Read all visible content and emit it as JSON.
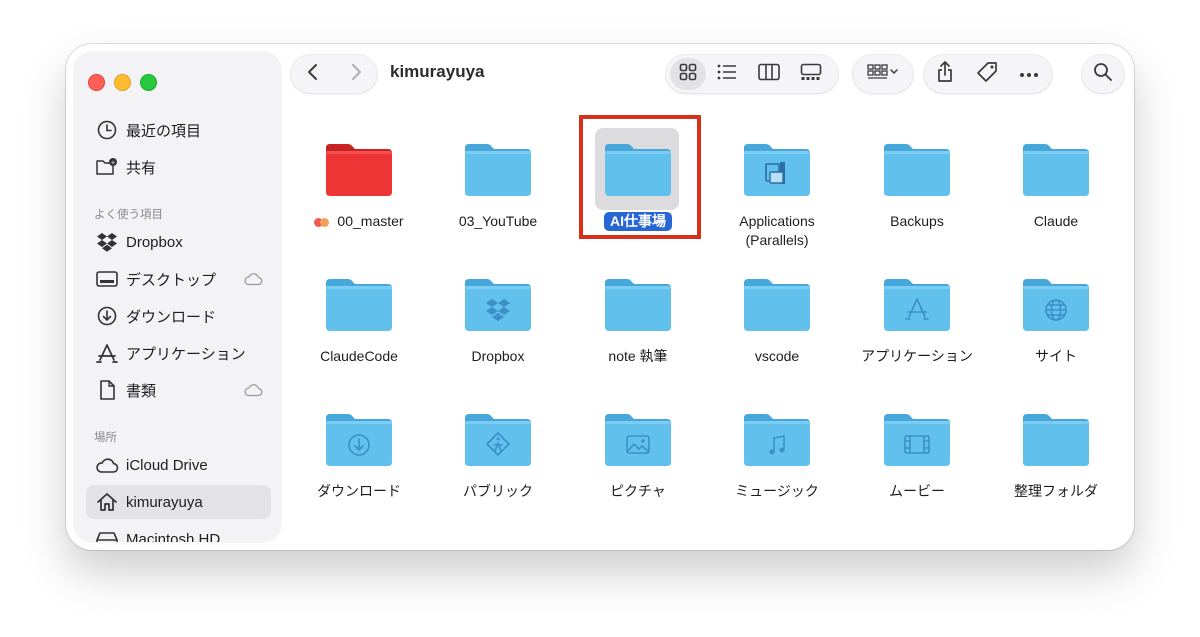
{
  "window": {
    "title": "kimurayuya"
  },
  "sidebar": {
    "top_items": [
      {
        "label": "最近の項目",
        "icon": "clock-icon"
      },
      {
        "label": "共有",
        "icon": "shared-folder-icon"
      }
    ],
    "favorites_header": "よく使う項目",
    "favorites": [
      {
        "label": "Dropbox",
        "icon": "dropbox-icon"
      },
      {
        "label": "デスクトップ",
        "icon": "desktop-icon",
        "cloud": true
      },
      {
        "label": "ダウンロード",
        "icon": "download-icon"
      },
      {
        "label": "アプリケーション",
        "icon": "applications-icon"
      },
      {
        "label": "書類",
        "icon": "document-icon",
        "cloud": true
      }
    ],
    "locations_header": "場所",
    "locations": [
      {
        "label": "iCloud Drive",
        "icon": "icloud-icon"
      },
      {
        "label": "kimurayuya",
        "icon": "home-icon",
        "selected": true
      },
      {
        "label": "Macintosh HD",
        "icon": "hard-drive-icon"
      }
    ]
  },
  "toolbar": {
    "back_icon": "chevron-left-icon",
    "forward_icon": "chevron-right-icon",
    "view_modes": [
      "icon-view-icon",
      "list-view-icon",
      "column-view-icon",
      "gallery-view-icon"
    ],
    "active_view": "icon-view-icon",
    "group_icon": "group-by-icon",
    "share_icon": "share-icon",
    "tag_icon": "tag-icon",
    "more_icon": "more-icon",
    "search_icon": "search-icon"
  },
  "items": [
    {
      "label": "00_master",
      "type": "red-folder",
      "tags": [
        "#f4574b",
        "#f5a05a"
      ]
    },
    {
      "label": "03_YouTube",
      "type": "folder"
    },
    {
      "label": "AI仕事場",
      "type": "folder",
      "selected": true
    },
    {
      "label": "Applications\n(Parallels)",
      "type": "parallels-folder"
    },
    {
      "label": "Backups",
      "type": "folder"
    },
    {
      "label": "Claude",
      "type": "folder"
    },
    {
      "label": "ClaudeCode",
      "type": "folder"
    },
    {
      "label": "Dropbox",
      "type": "dropbox-folder"
    },
    {
      "label": "note 執筆",
      "type": "folder"
    },
    {
      "label": "vscode",
      "type": "folder"
    },
    {
      "label": "アプリケーション",
      "type": "apps-folder"
    },
    {
      "label": "サイト",
      "type": "sites-folder"
    },
    {
      "label": "ダウンロード",
      "type": "downloads-folder"
    },
    {
      "label": "パブリック",
      "type": "public-folder"
    },
    {
      "label": "ピクチャ",
      "type": "pictures-folder"
    },
    {
      "label": "ミュージック",
      "type": "music-folder"
    },
    {
      "label": "ムービー",
      "type": "movies-folder"
    },
    {
      "label": "整理フォルダ",
      "type": "folder"
    }
  ],
  "colors": {
    "folder_blue": "#5cbde8",
    "folder_tab": "#4fb0e0",
    "red_folder": "#e93434",
    "selection": "#2866d6",
    "highlight_box": "#d8311b"
  }
}
